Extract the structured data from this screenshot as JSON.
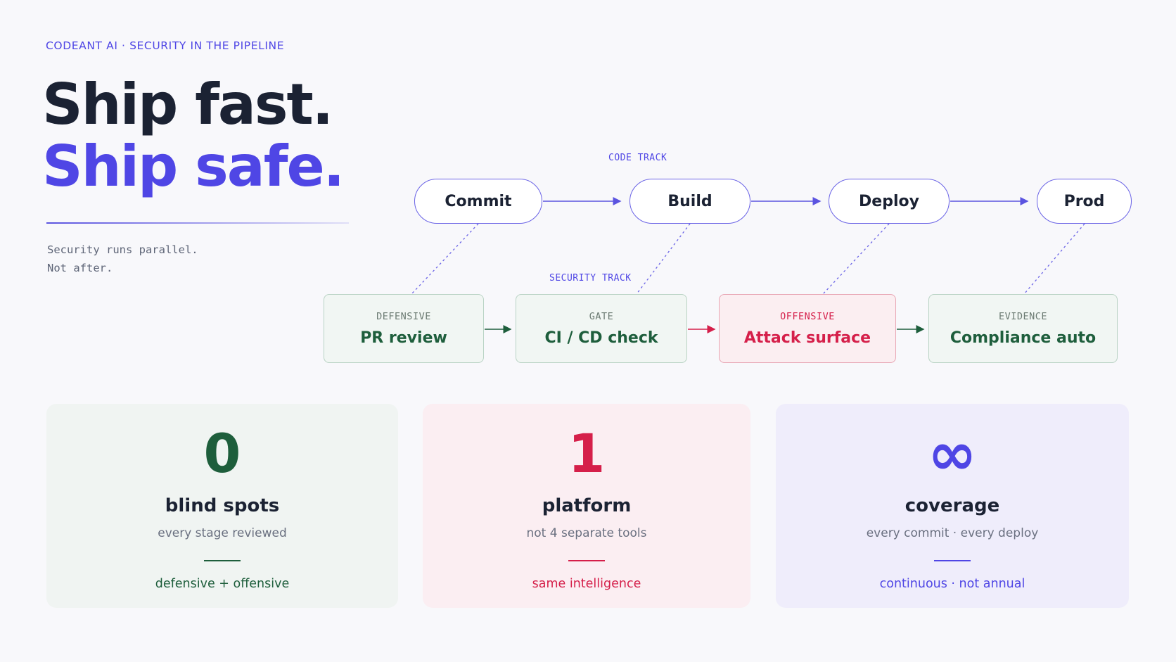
{
  "eyebrow": "CODEANT AI · SECURITY IN THE PIPELINE",
  "headline": {
    "line1": "Ship fast.",
    "line2": "Ship safe."
  },
  "subtitle": {
    "line1": "Security runs parallel.",
    "line2": "Not after."
  },
  "code_track": {
    "label": "CODE TRACK",
    "stages": [
      "Commit",
      "Build",
      "Deploy",
      "Prod"
    ]
  },
  "security_track": {
    "label": "SECURITY TRACK",
    "boxes": [
      {
        "tag": "DEFENSIVE",
        "title": "PR review"
      },
      {
        "tag": "GATE",
        "title": "CI / CD check"
      },
      {
        "tag": "OFFENSIVE",
        "title": "Attack surface"
      },
      {
        "tag": "EVIDENCE",
        "title": "Compliance auto"
      }
    ]
  },
  "stats": [
    {
      "value": "0",
      "label": "blind spots",
      "desc": "every stage reviewed",
      "foot": "defensive + offensive"
    },
    {
      "value": "1",
      "label": "platform",
      "desc": "not 4 separate tools",
      "foot": "same intelligence"
    },
    {
      "value": "∞",
      "label": "coverage",
      "desc": "every commit · every deploy",
      "foot": "continuous · not annual"
    }
  ],
  "colors": {
    "accent": "#4f46e5",
    "defensive": "#1e5e3c",
    "offensive": "#d51f4a",
    "ink": "#1b2233"
  }
}
